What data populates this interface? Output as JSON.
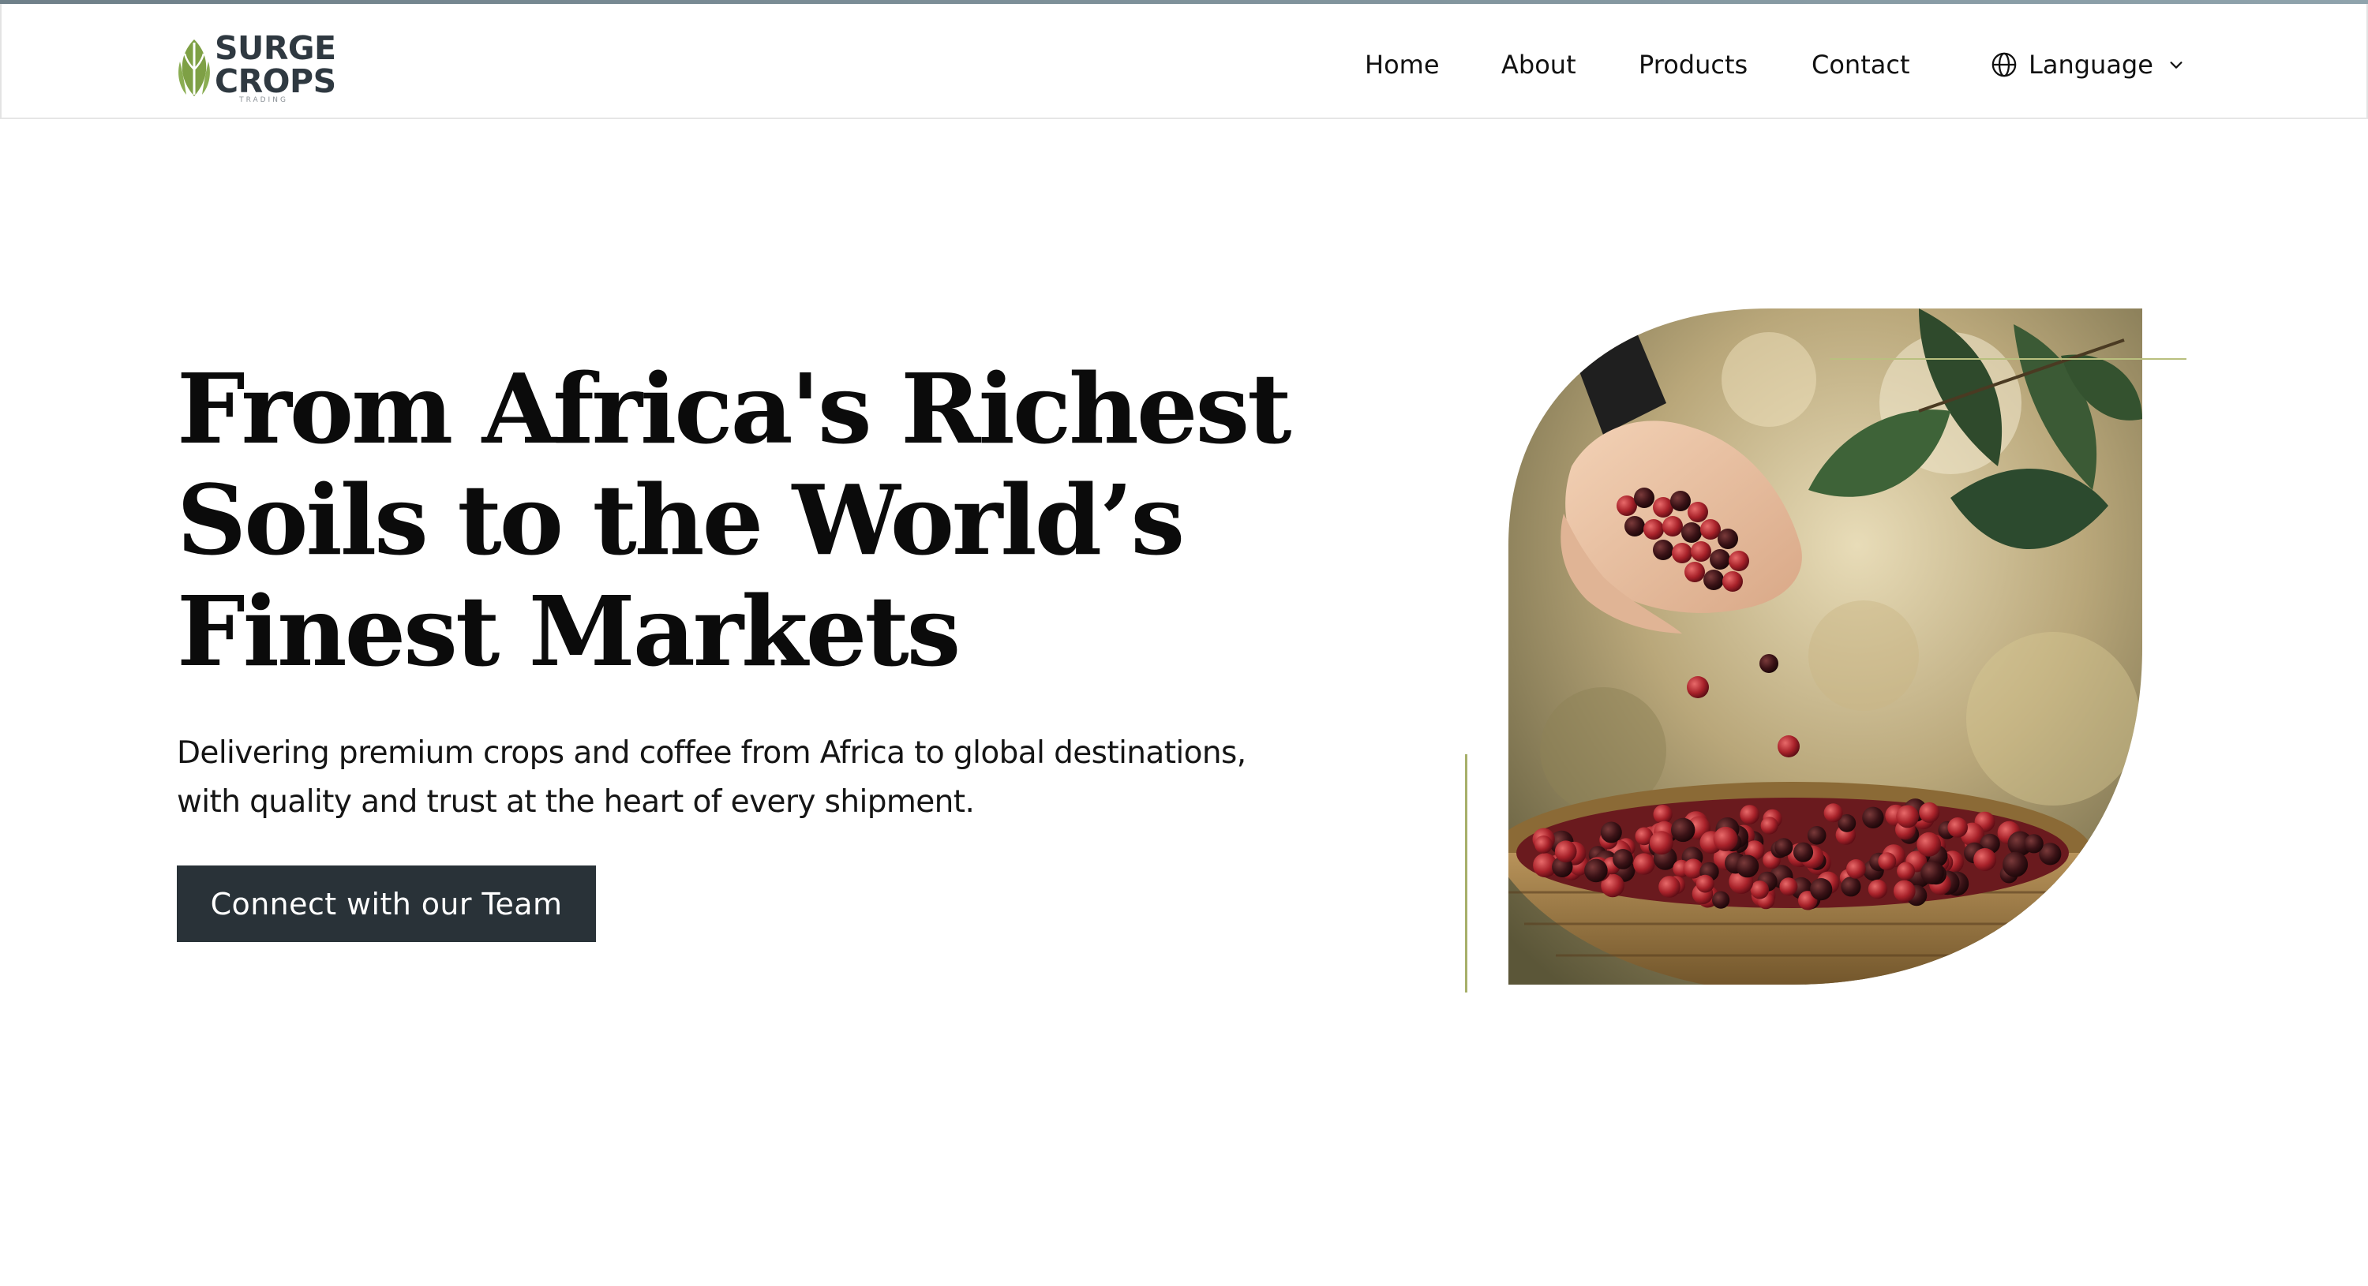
{
  "brand": {
    "name_line1": "SURGE",
    "name_line2": "CROPS",
    "tagline": "TRADING",
    "logo_color": "#7ea045"
  },
  "nav": {
    "items": [
      {
        "label": "Home"
      },
      {
        "label": "About"
      },
      {
        "label": "Products"
      },
      {
        "label": "Contact"
      }
    ],
    "language": {
      "label": "Language",
      "icon": "globe-icon",
      "caret": "chevron-down-icon"
    }
  },
  "hero": {
    "title_lines": [
      "From Africa's Richest",
      "Soils to the World’s",
      "Finest Markets"
    ],
    "subtitle_lines": [
      "Delivering premium crops and coffee from Africa to global destinations,",
      "with quality and trust at the heart of every shipment."
    ],
    "cta_label": "Connect with our Team",
    "image": "coffee-cherries-photo"
  },
  "colors": {
    "button_bg": "#293238",
    "accent_line": "#a7b06a",
    "text": "#0b0b0b"
  }
}
